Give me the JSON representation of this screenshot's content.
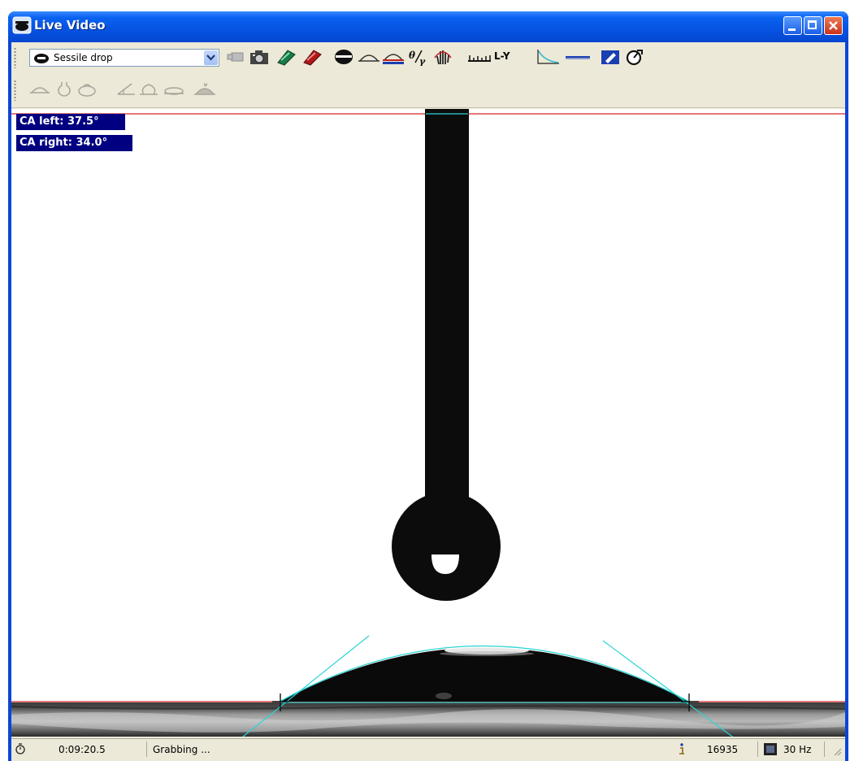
{
  "window": {
    "title": "Live Video"
  },
  "toolbar": {
    "mode_select": {
      "value": "Sessile drop"
    },
    "ly_label": "L-Y",
    "icons": [
      "video-source-icon",
      "snapshot-icon",
      "record-icon",
      "stop-record-icon",
      "drop-icon",
      "baseline-icon",
      "baseline-mirror-icon",
      "theta-gamma-icon",
      "hand-tool-icon",
      "ruler-icon",
      "tangent-icon",
      "needle-line-icon",
      "edit-icon",
      "settings-dial-icon"
    ]
  },
  "toolbar2": {
    "icons": [
      "sessile-profile-icon",
      "pendant-profile-icon",
      "ellipse-profile-icon",
      "angle-profile-icon",
      "circle-profile-icon",
      "flat-profile-icon",
      "height-profile-icon"
    ]
  },
  "video": {
    "ca_left": "CA left:  37.5°",
    "ca_right": "CA right: 34.0°"
  },
  "status": {
    "time": "0:09:20.5",
    "state": "Grabbing ...",
    "frame_count": "16935",
    "frame_rate": "30 Hz"
  },
  "colors": {
    "title_blue": "#0654e4",
    "ca_label_bg": "#000080",
    "baseline_red": "#d62828",
    "tangent_cyan": "#2ad4d4",
    "drop_black": "#0c0c0c"
  }
}
